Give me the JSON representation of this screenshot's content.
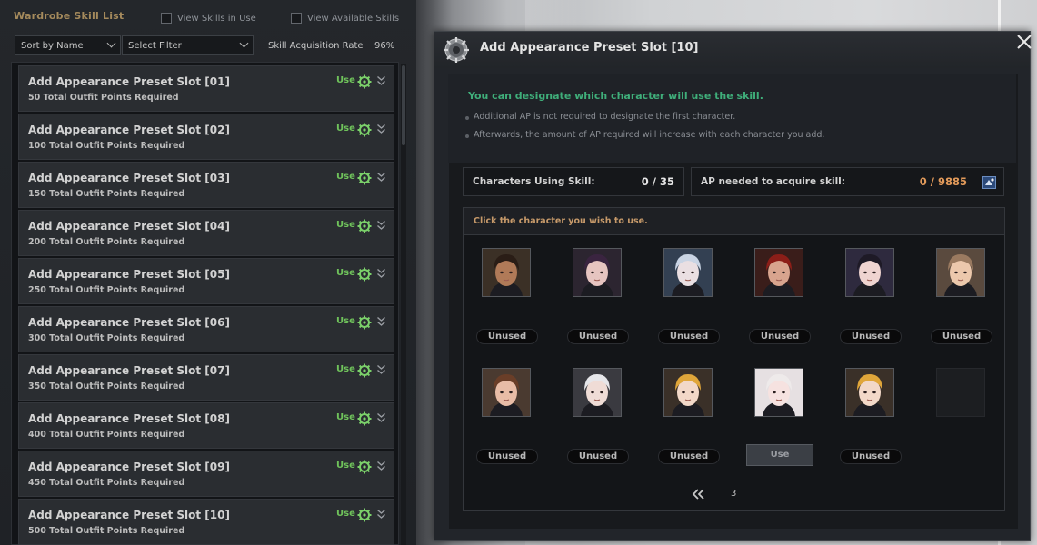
{
  "left_panel": {
    "title": "Wardrobe Skill List",
    "view_in_use": "View Skills in Use",
    "view_available": "View Available Skills",
    "sort_dropdown": "Sort by Name",
    "filter_dropdown": "Select Filter",
    "rate_label": "Skill Acquisition Rate",
    "rate_value": "96%",
    "skills": [
      {
        "name": "Add Appearance Preset Slot [01]",
        "requirement": "50 Total Outfit Points Required",
        "action": "Use"
      },
      {
        "name": "Add Appearance Preset Slot [02]",
        "requirement": "100 Total Outfit Points Required",
        "action": "Use"
      },
      {
        "name": "Add Appearance Preset Slot [03]",
        "requirement": "150 Total Outfit Points Required",
        "action": "Use"
      },
      {
        "name": "Add Appearance Preset Slot [04]",
        "requirement": "200 Total Outfit Points Required",
        "action": "Use"
      },
      {
        "name": "Add Appearance Preset Slot [05]",
        "requirement": "250 Total Outfit Points Required",
        "action": "Use"
      },
      {
        "name": "Add Appearance Preset Slot [06]",
        "requirement": "300 Total Outfit Points Required",
        "action": "Use"
      },
      {
        "name": "Add Appearance Preset Slot [07]",
        "requirement": "350 Total Outfit Points Required",
        "action": "Use"
      },
      {
        "name": "Add Appearance Preset Slot [08]",
        "requirement": "400 Total Outfit Points Required",
        "action": "Use"
      },
      {
        "name": "Add Appearance Preset Slot [09]",
        "requirement": "450 Total Outfit Points Required",
        "action": "Use"
      },
      {
        "name": "Add Appearance Preset Slot [10]",
        "requirement": "500 Total Outfit Points Required",
        "action": "Use"
      }
    ]
  },
  "dialog": {
    "title": "Add Appearance Preset Slot [10]",
    "notice_heading": "You can designate which character will use the skill.",
    "notice_bullets": [
      "Additional AP is not required to designate the first character.",
      "Afterwards, the amount of AP required will increase with each character you add."
    ],
    "characters_label": "Characters Using Skill:",
    "characters_value": "0 / 35",
    "ap_label": "AP needed to acquire skill:",
    "ap_value": "0 / 9885",
    "grid_header": "Click the character you wish to use.",
    "characters": [
      {
        "button": "Unused",
        "skin": "#b07a58",
        "hair": "#2a1d16",
        "bg": "#3b3026"
      },
      {
        "button": "Unused",
        "skin": "#e6c4c0",
        "hair": "#3a2440",
        "bg": "#2c2530"
      },
      {
        "button": "Unused",
        "skin": "#eadfe2",
        "hair": "#c9d4e4",
        "bg": "#334052"
      },
      {
        "button": "Unused",
        "skin": "#d8a48e",
        "hair": "#8c1e18",
        "bg": "#3a1d1a"
      },
      {
        "button": "Unused",
        "skin": "#efd4d0",
        "hair": "#1e1a26",
        "bg": "#2e2a3e"
      },
      {
        "button": "Unused",
        "skin": "#ecc8ac",
        "hair": "#9a7a60",
        "bg": "#5a4a3e"
      },
      {
        "button": "Unused",
        "skin": "#e8bca6",
        "hair": "#6a3e28",
        "bg": "#4a3a30"
      },
      {
        "button": "Unused",
        "skin": "#efdcd6",
        "hair": "#e6e6ea",
        "bg": "#3a3a40"
      },
      {
        "button": "Unused",
        "skin": "#f2d8c8",
        "hair": "#e0a63a",
        "bg": "#3a3028"
      },
      {
        "button": "Use",
        "skin": "#f6e2e0",
        "hair": "#eeeaea",
        "bg": "#e6e0e2"
      },
      {
        "button": "Unused",
        "skin": "#f2d8c8",
        "hair": "#e0a63a",
        "bg": "#3a3028"
      },
      {
        "button": "",
        "empty": true
      }
    ],
    "page": "3"
  }
}
